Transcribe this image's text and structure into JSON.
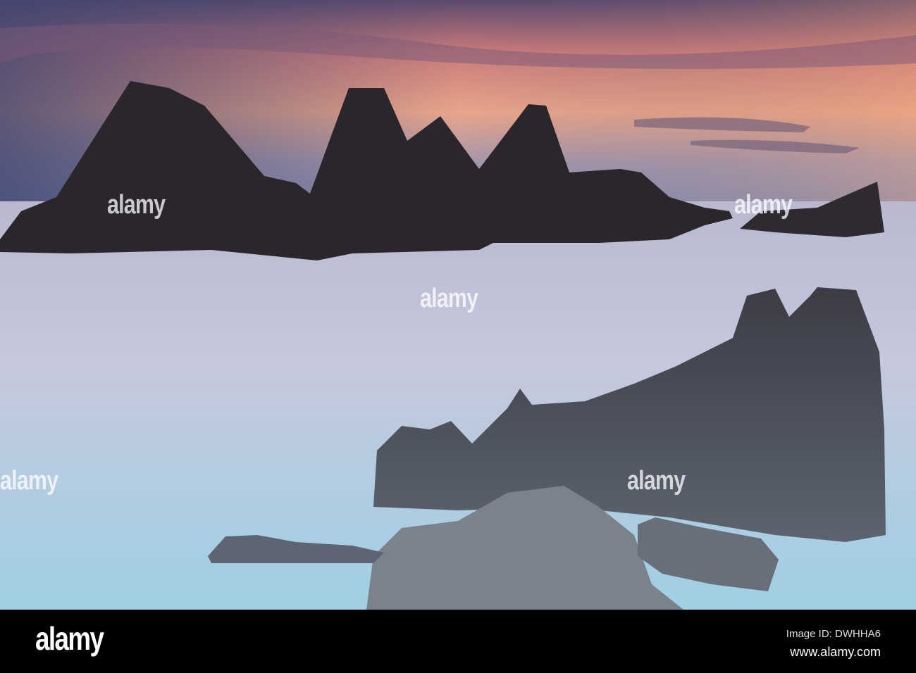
{
  "watermark": {
    "brand": "alamy"
  },
  "footer": {
    "logo": "alamy",
    "image_id": "Image ID: DWHHA6",
    "site": "www.alamy.com"
  }
}
